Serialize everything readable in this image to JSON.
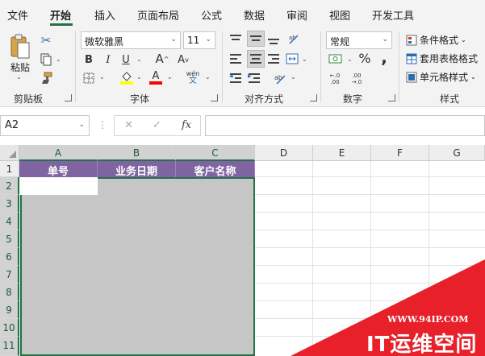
{
  "tabs": [
    "文件",
    "开始",
    "插入",
    "页面布局",
    "公式",
    "数据",
    "审阅",
    "视图",
    "开发工具"
  ],
  "active_tab_index": 1,
  "ribbon": {
    "clipboard": {
      "paste_label": "粘贴",
      "group_label": "剪贴板"
    },
    "font": {
      "family": "微软雅黑",
      "size": "11",
      "bold": "B",
      "italic": "I",
      "underline": "U",
      "grow": "A",
      "shrink": "A",
      "font_color_glyph": "A",
      "pinyin_glyph": "wén",
      "group_label": "字体",
      "highlight_color": "#ffff00",
      "font_color": "#ff0000"
    },
    "alignment": {
      "group_label": "对齐方式"
    },
    "number": {
      "format": "常规",
      "percent": "%",
      "comma": ",",
      "group_label": "数字"
    },
    "styles": {
      "conditional": "条件格式",
      "table": "套用表格格式",
      "cell": "单元格样式",
      "group_label": "样式"
    }
  },
  "formula_bar": {
    "name_box": "A2",
    "cancel": "✕",
    "enter": "✓",
    "fx": "fx",
    "value": ""
  },
  "columns": [
    "A",
    "B",
    "C",
    "D",
    "E",
    "F",
    "G"
  ],
  "rows": [
    "1",
    "2",
    "3",
    "4",
    "5",
    "6",
    "7",
    "8",
    "9",
    "10",
    "11"
  ],
  "headers": [
    "单号",
    "业务日期",
    "客户名称"
  ],
  "watermark": {
    "url": "WWW.94IP.COM",
    "name": "IT运维空间"
  },
  "colors": {
    "accent": "#217346",
    "header_fill": "#8064a2",
    "selection": "#c6c6c6",
    "watermark": "#e8202a"
  }
}
